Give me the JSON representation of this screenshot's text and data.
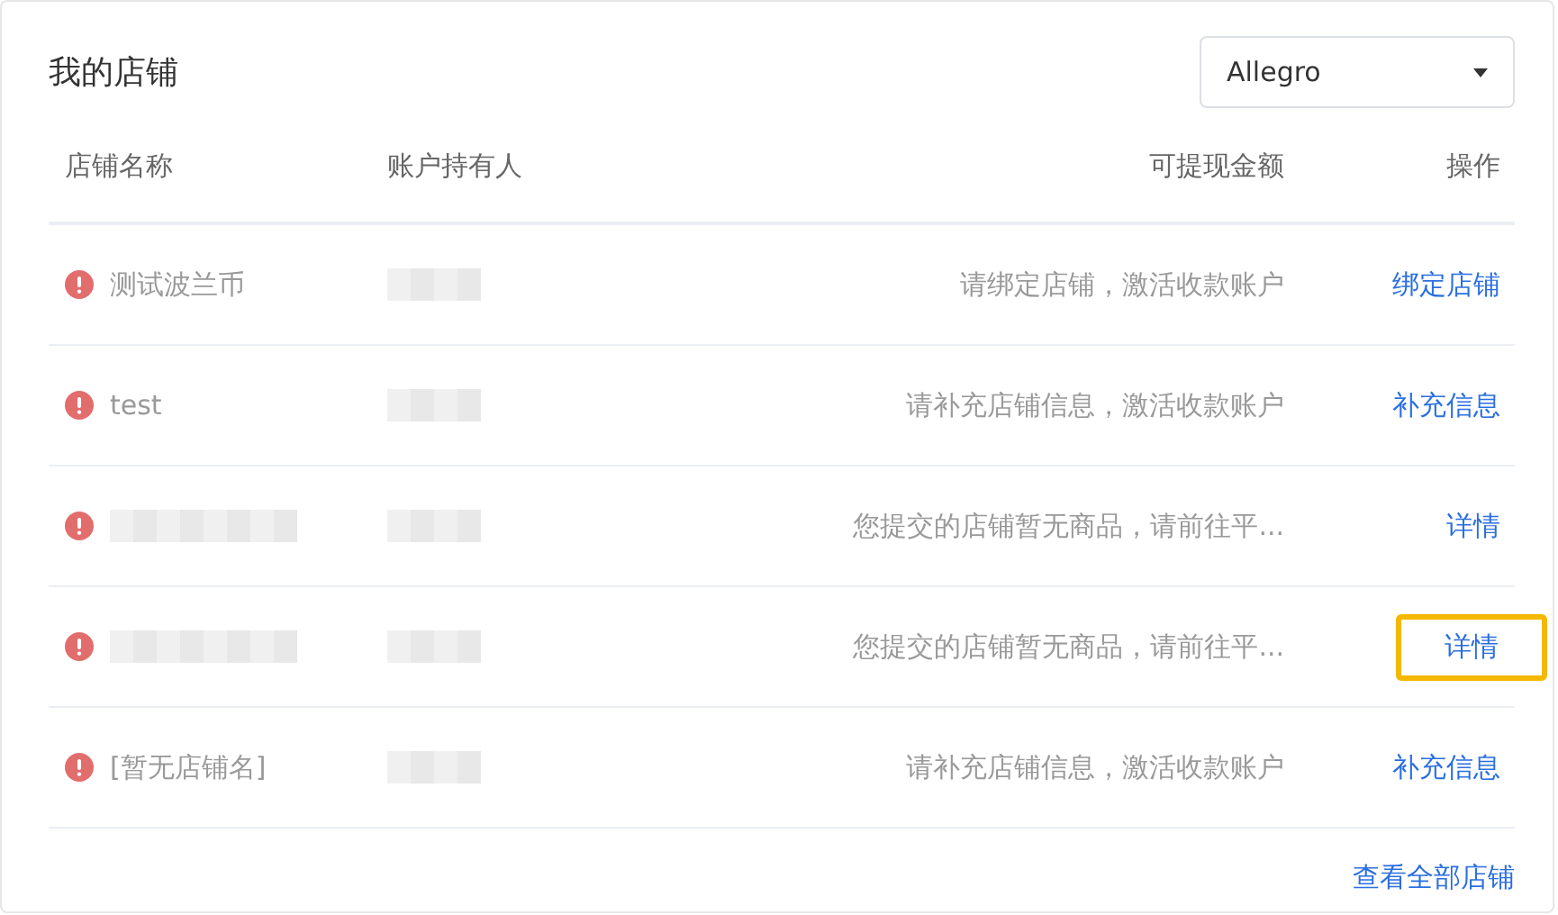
{
  "title": "我的店铺",
  "platform_select": {
    "value": "Allegro"
  },
  "columns": [
    "店铺名称",
    "账户持有人",
    "可提现金额",
    "操作"
  ],
  "rows": [
    {
      "name": "测试波兰币",
      "name_redacted": false,
      "holder_redacted": true,
      "status": "请绑定店铺，激活收款账户",
      "action": "绑定店铺",
      "highlighted": false
    },
    {
      "name": "test",
      "name_redacted": false,
      "holder_redacted": true,
      "status": "请补充店铺信息，激活收款账户",
      "action": "补充信息",
      "highlighted": false
    },
    {
      "name_redacted": true,
      "holder_redacted": true,
      "status": "您提交的店铺暂无商品，请前往平...",
      "action": "详情",
      "highlighted": false
    },
    {
      "name_redacted": true,
      "holder_redacted": true,
      "status": "您提交的店铺暂无商品，请前往平...",
      "action": "详情",
      "highlighted": true
    },
    {
      "name": "[暂无店铺名]",
      "name_redacted": false,
      "holder_redacted": true,
      "status": "请补充店铺信息，激活收款账户",
      "action": "补充信息",
      "highlighted": false
    }
  ],
  "footer_link": "查看全部店铺"
}
